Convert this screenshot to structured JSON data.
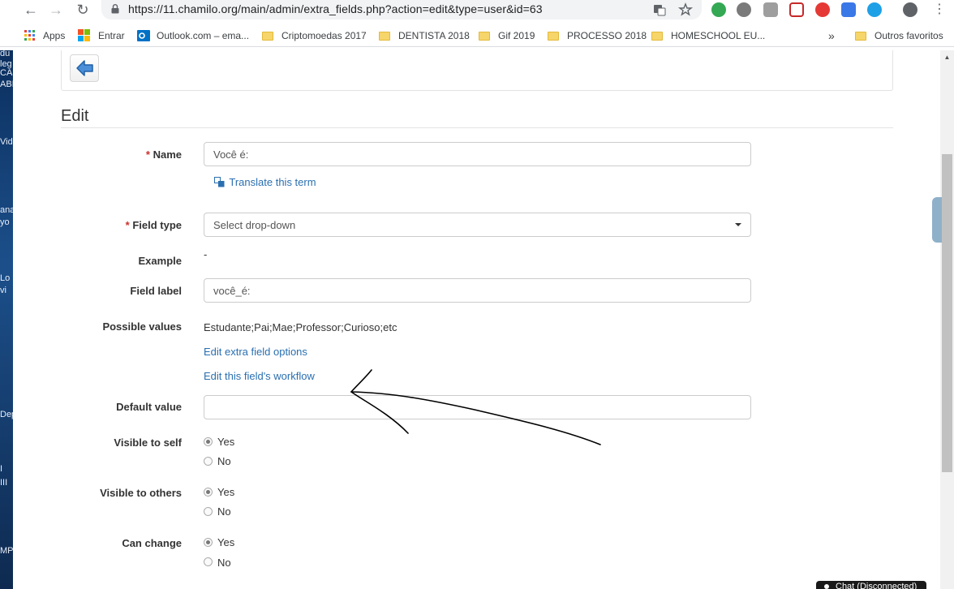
{
  "browser": {
    "url": "https://11.chamilo.org/main/admin/extra_fields.php?action=edit&type=user&id=63",
    "bookmarks": [
      "Apps",
      "Entrar",
      "Outlook.com – ema...",
      "Criptomoedas 2017",
      "DENTISTA 2018",
      "Gif 2019",
      "PROCESSO 2018",
      "HOMESCHOOL EU...",
      "Outros favoritos"
    ],
    "more_label": "»"
  },
  "desktop_fragments": [
    "du",
    "leg",
    "CAS",
    "ABI",
    "Vid",
    "ana",
    "yo",
    "Lo",
    "vi",
    "Dep",
    "I",
    "III",
    "MP"
  ],
  "page": {
    "title": "Edit",
    "required_mark": "*",
    "name_label": "Name",
    "name_value": "Você é:",
    "translate_link": "Translate this term",
    "field_type_label": "Field type",
    "field_type_value": "Select drop-down",
    "example_label": "Example",
    "example_value": "-",
    "field_label_label": "Field label",
    "field_label_value": "você_é:",
    "possible_values_label": "Possible values",
    "possible_values_value": "Estudante;Pai;Mae;Professor;Curioso;etc",
    "edit_options_link": "Edit extra field options",
    "edit_workflow_link": "Edit this field's workflow",
    "default_value_label": "Default value",
    "default_value_value": "",
    "visible_self_label": "Visible to self",
    "visible_others_label": "Visible to others",
    "can_change_label": "Can change",
    "yes": "Yes",
    "no": "No"
  },
  "chat": {
    "label": "Chat (Disconnected)"
  }
}
